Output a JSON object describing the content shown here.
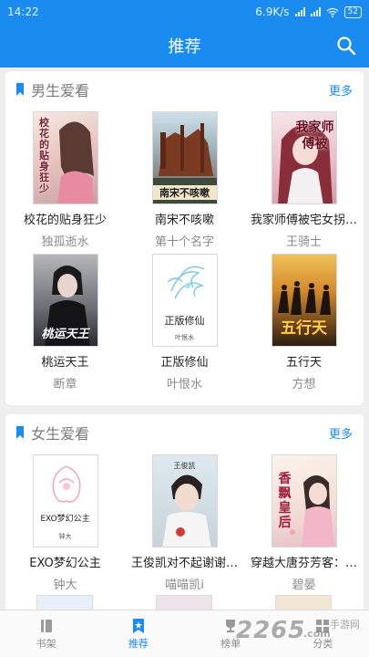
{
  "status": {
    "time": "14:22",
    "speed": "6.9K/s",
    "battery": "52"
  },
  "header": {
    "title": "推荐"
  },
  "sections": [
    {
      "name": "男生爱看",
      "more": "更多",
      "books": [
        {
          "title": "校花的贴身狂少",
          "author": "独孤逝水",
          "cover_text": "校花的贴身狂少"
        },
        {
          "title": "南宋不咳嗽",
          "author": "第十个名字",
          "cover_text": "南宋不咳嗽"
        },
        {
          "title": "我家师傅被宅女拐…",
          "author": "王骑士",
          "cover_text": "我家师傅被"
        },
        {
          "title": "桃运天王",
          "author": "断章",
          "cover_text": "桃运天王"
        },
        {
          "title": "正版修仙",
          "author": "叶恨水",
          "cover_text": "正版修仙",
          "cover_author": "叶恨水"
        },
        {
          "title": "五行天",
          "author": "方想",
          "cover_text": "五行天"
        }
      ]
    },
    {
      "name": "女生爱看",
      "more": "更多",
      "books": [
        {
          "title": "EXO梦幻公主",
          "author": "钟大",
          "cover_text": "EXO梦幻公主",
          "cover_author": "钟大"
        },
        {
          "title": "王俊凯对不起谢谢…",
          "author": "喵喵凯i",
          "cover_text": "王俊凯"
        },
        {
          "title": "穿越大唐芬芳客：…",
          "author": "碧晏",
          "cover_text": "香飘皇后"
        }
      ]
    }
  ],
  "tabs": [
    {
      "label": "书架",
      "icon": "book-icon"
    },
    {
      "label": "推荐",
      "icon": "bookmark-icon"
    },
    {
      "label": "榜单",
      "icon": "trophy-icon"
    },
    {
      "label": "分类",
      "icon": "grid-icon"
    }
  ],
  "watermark": {
    "text": "2265",
    "suffix": ".com",
    "sub": "手游网"
  },
  "colors": {
    "accent": "#1a8cf0",
    "background": "#eeeeee"
  }
}
